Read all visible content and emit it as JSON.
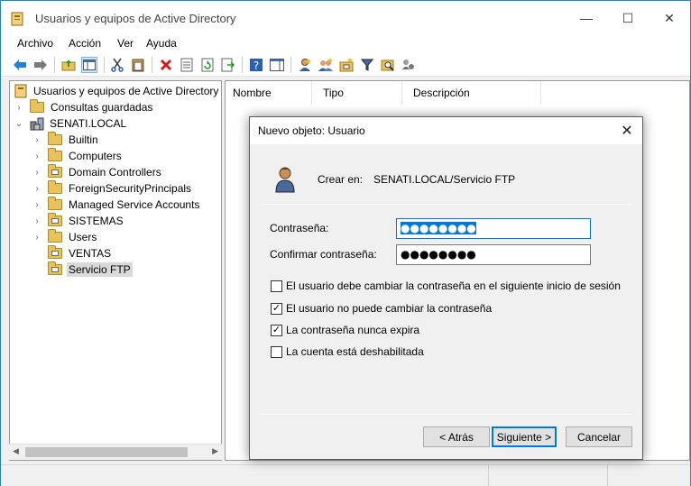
{
  "window": {
    "title": "Usuarios y equipos de Active Directory",
    "minimize": "—",
    "maximize": "☐",
    "close": "✕"
  },
  "menu": [
    "Archivo",
    "Acción",
    "Ver",
    "Ayuda"
  ],
  "toolbar": {
    "icons": [
      "back-icon",
      "forward-icon",
      "up-folder-icon",
      "show-console-tree-icon",
      "cut-icon",
      "paste-icon",
      "delete-icon",
      "properties-icon",
      "refresh-icon",
      "export-list-icon",
      "help-icon",
      "action-pane-icon",
      "new-user-icon",
      "new-group-icon",
      "new-ou-icon",
      "filter-icon",
      "find-icon",
      "add-to-group-icon"
    ]
  },
  "tree": {
    "root": "Usuarios y equipos de Active Directory [",
    "saved_queries": "Consultas guardadas",
    "domain": "SENATI.LOCAL",
    "items": [
      {
        "label": "Builtin",
        "expandable": true,
        "ou": false
      },
      {
        "label": "Computers",
        "expandable": true,
        "ou": false
      },
      {
        "label": "Domain Controllers",
        "expandable": true,
        "ou": true
      },
      {
        "label": "ForeignSecurityPrincipals",
        "expandable": true,
        "ou": false
      },
      {
        "label": "Managed Service Accounts",
        "expandable": true,
        "ou": false
      },
      {
        "label": "SISTEMAS",
        "expandable": true,
        "ou": true
      },
      {
        "label": "Users",
        "expandable": true,
        "ou": false
      },
      {
        "label": "VENTAS",
        "expandable": false,
        "ou": true
      },
      {
        "label": "Servicio FTP",
        "expandable": false,
        "ou": true,
        "selected": true
      }
    ]
  },
  "list": {
    "columns": [
      "Nombre",
      "Tipo",
      "Descripción"
    ]
  },
  "dialog": {
    "title": "Nuevo objeto: Usuario",
    "close": "✕",
    "create_in_label": "Crear en:",
    "create_in_path": "SENATI.LOCAL/Servicio FTP",
    "password_label": "Contraseña:",
    "password_value": "●●●●●●●●",
    "confirm_label": "Confirmar contraseña:",
    "confirm_value": "●●●●●●●●",
    "options": [
      {
        "label": "El usuario debe cambiar la contraseña en el siguiente inicio de sesión",
        "checked": false
      },
      {
        "label": "El usuario no puede cambiar la contraseña",
        "checked": true
      },
      {
        "label": "La contraseña nunca expira",
        "checked": true
      },
      {
        "label": "La cuenta está deshabilitada",
        "checked": false
      }
    ],
    "back_button": "< Atrás",
    "next_button": "Siguiente >",
    "cancel_button": "Cancelar"
  },
  "colors": {
    "accent": "#0078d7",
    "folder": "#e8c25a"
  }
}
